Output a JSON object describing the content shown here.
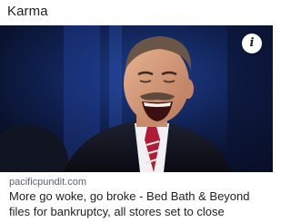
{
  "header": {
    "title": "Karma"
  },
  "card": {
    "image_alt_icon": "info-icon",
    "info_glyph": "i",
    "source": "pacificpundit.com",
    "headline": "More go woke, go broke - Bed Bath & Beyond files for bankruptcy, all stores set to close"
  },
  "colors": {
    "text_primary": "#202124",
    "text_secondary": "#5f6368",
    "background": "#ffffff"
  }
}
